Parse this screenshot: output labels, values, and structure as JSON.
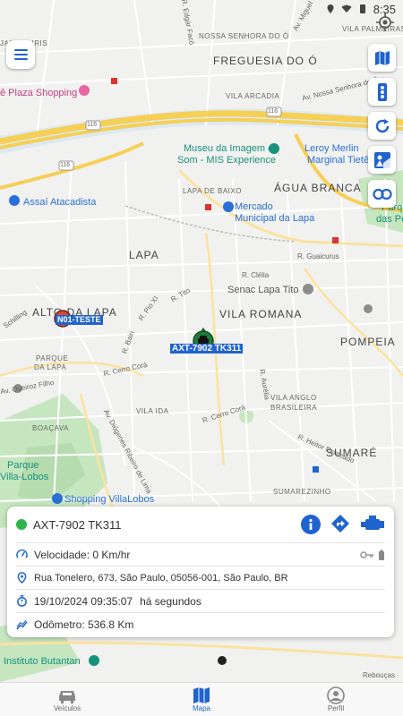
{
  "status_bar": {
    "time": "8:35",
    "icons": [
      "location-icon",
      "wifi-icon",
      "battery-icon"
    ]
  },
  "map": {
    "labels": {
      "jardim_iris": "JARDIM IRIS",
      "nossa_senhora_do_o": "NOSSA SENHORA DO Ó",
      "vila_palmeiras": "VILA PALMEIRAS",
      "freguesia_do_o": "FREGUESIA DO Ó",
      "vila_arcadia": "VILA ARCADIA",
      "plaza_shopping": "ê Plaza Shopping",
      "museu": "Museu da Imagem e",
      "museu2": "Som - MIS Experience",
      "leroy": "Leroy Merlin",
      "leroy2": "Marginal Tietê",
      "lapa_de_baixo": "LAPA DE BAIXO",
      "agua_branca": "ÁGUA BRANCA",
      "assai": "Assaí Atacadista",
      "mercado": "Mercado",
      "mercado2": "Municipal da Lapa",
      "parque_perdiz": "Parque",
      "parque_perdiz2": "das Perdiz",
      "lapa": "LAPA",
      "r_guaicurus": "R. Guaicurus",
      "r_clelia": "R. Clélia",
      "senac": "Senac Lapa Tito",
      "alto_da_lapa": "ALTO DA LAPA",
      "vila_romana": "VILA ROMANA",
      "pompeia": "POMPEIA",
      "parque_da_lapa": "PARQUE",
      "parque_da_lapa2": "DA LAPA",
      "vila_ida": "VILA IDA",
      "vila_anglo": "VILA ANGLO",
      "vila_anglo2": "BRASILEIRA",
      "boacava": "BOAÇAVA",
      "sumare": "SUMARÉ",
      "parque_villa": "Parque",
      "parque_villa2": "Villa-Lobos",
      "shopping_villalobos": "Shopping VillaLobos",
      "sumarezinho": "SUMAREZINHO",
      "instituto_butantan": "Instituto Butantan",
      "r_heitor_penteado": "R. Heitor Penteado",
      "r_cerro_cora": "R. Cerro Corá",
      "r_tito": "R. Tito",
      "r_aurelia": "R. Aurélia",
      "av_queiroz": "Av. Queiroz Filho",
      "av_nsa": "Av. Nossa Senhora do Ó",
      "av_miguel": "Av. Miguel C",
      "r_pio_xi": "R. Pio XI",
      "r_bairi": "R. Bairi",
      "av_diogenes": "Av. Diógenes Ribeiro de Lima",
      "r_schilling": "Schilling",
      "highway_116_a": "116",
      "highway_116_b": "116",
      "highway_116_c": "116",
      "edgar": "R. Edgar Facó",
      "reboucas": "Rebouças"
    }
  },
  "markers": {
    "vehicle_label": "AXT-7902 TK311",
    "n01_label": "N01-TESTE"
  },
  "tools": [
    "map-icon",
    "traffic-light-icon",
    "refresh-icon",
    "street-view-icon",
    "link-icon"
  ],
  "card": {
    "vehicle": "AXT-7902 TK311",
    "status_color": "#2bb54a",
    "speed": "Velocidade: 0 Km/hr",
    "address": "Rua Tonelero, 673, São Paulo, 05056-001, São Paulo, BR",
    "datetime": "19/10/2024 09:35:07",
    "ago": "há segundos",
    "odometer": "Odômetro: 536.8 Km"
  },
  "nav": {
    "vehicles": "Veículos",
    "map": "Mapa",
    "profile": "Perfil"
  },
  "colors": {
    "accent": "#1f63cf",
    "highway": "#f7d15a",
    "park": "#b9dfb4",
    "water": "#aad3f0"
  }
}
